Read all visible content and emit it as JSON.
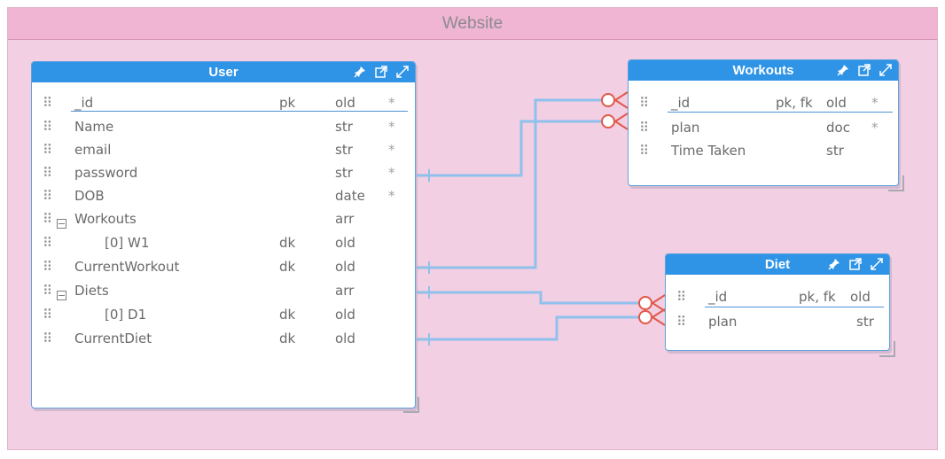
{
  "diagram": {
    "title": "Website"
  },
  "entities": {
    "user": {
      "title": "User",
      "rows": [
        {
          "name": "_id",
          "key": "pk",
          "type": "old",
          "req": "*"
        },
        {
          "name": "Name",
          "key": "",
          "type": "str",
          "req": "*"
        },
        {
          "name": "email",
          "key": "",
          "type": "str",
          "req": "*"
        },
        {
          "name": "password",
          "key": "",
          "type": "str",
          "req": "*"
        },
        {
          "name": "DOB",
          "key": "",
          "type": "date",
          "req": "*"
        },
        {
          "name": "Workouts",
          "key": "",
          "type": "arr",
          "req": ""
        },
        {
          "name": "[0] W1",
          "key": "dk",
          "type": "old",
          "req": ""
        },
        {
          "name": "CurrentWorkout",
          "key": "dk",
          "type": "old",
          "req": ""
        },
        {
          "name": "Diets",
          "key": "",
          "type": "arr",
          "req": ""
        },
        {
          "name": "[0] D1",
          "key": "dk",
          "type": "old",
          "req": ""
        },
        {
          "name": "CurrentDiet",
          "key": "dk",
          "type": "old",
          "req": ""
        }
      ]
    },
    "workouts": {
      "title": "Workouts",
      "rows": [
        {
          "name": "_id",
          "key": "pk, fk",
          "type": "old",
          "req": "*"
        },
        {
          "name": "plan",
          "key": "",
          "type": "doc",
          "req": "*"
        },
        {
          "name": "Time Taken",
          "key": "",
          "type": "str",
          "req": ""
        }
      ]
    },
    "diet": {
      "title": "Diet",
      "rows": [
        {
          "name": "_id",
          "key": "pk, fk",
          "type": "old",
          "req": ""
        },
        {
          "name": "plan",
          "key": "",
          "type": "str",
          "req": ""
        }
      ]
    }
  },
  "colors": {
    "canvas": "#f2cfe2",
    "title_bar": "#efb5d3",
    "entity_header": "#2f93e6",
    "link_line": "#8fc1ec",
    "crowfoot": "#e0584a"
  },
  "icons": [
    "pin-icon",
    "open-external-icon",
    "expand-icon",
    "drag-grip-icon",
    "collapse-icon",
    "resize-handle-icon"
  ]
}
